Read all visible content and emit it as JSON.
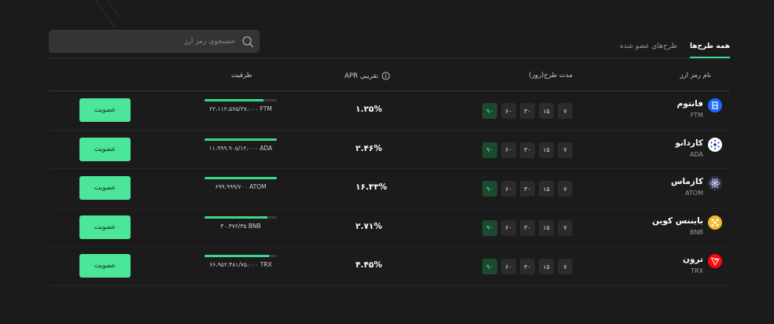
{
  "search": {
    "placeholder": "جستجوی رمز ارز"
  },
  "tabs": [
    {
      "label": "همه طرح‌ها"
    },
    {
      "label": "طرح‌های عضو شده"
    }
  ],
  "table": {
    "headers": {
      "name": "نام رمز ارز",
      "period": "مدت طرح(روز)",
      "apr": "APR تقریبی",
      "capacity": "ظرفیت"
    },
    "period_options": [
      "۷",
      "۱۵",
      "۳۰",
      "۶۰",
      "۹۰"
    ],
    "join_label": "عضویت",
    "rows": [
      {
        "name": "فانتوم",
        "symbol": "FTM",
        "apr": "۱.۲۵%",
        "capacity": "۲۲،۱۱۲،۵۶۵/۲۷،۰۰۰ FTM",
        "fill": 0.82,
        "icon_color": "#1969ff"
      },
      {
        "name": "کاردانو",
        "symbol": "ADA",
        "apr": "۲.۴۶%",
        "capacity": "۱۱،۹۹۹.۹۰۵/۱۲،۰۰۰ ADA",
        "fill": 1.0,
        "icon_color": "#ffffff"
      },
      {
        "name": "کازماس",
        "symbol": "ATOM",
        "apr": "۱۶.۳۳%",
        "capacity": "۶۹۹.۹۹۹/۷۰۰ ATOM",
        "fill": 1.0,
        "icon_color": "#2e3148"
      },
      {
        "name": "بایننس کوین",
        "symbol": "BNB",
        "apr": "۲.۷۱%",
        "capacity": "۳۰.۳۷۶/۳۵ BNB",
        "fill": 0.87,
        "icon_color": "#f3ba2f"
      },
      {
        "name": "ترون",
        "symbol": "TRX",
        "apr": "۴.۴۵%",
        "capacity": "۶۶،۹۵۲.۴۸۱/۷۵،۰۰۰ TRX",
        "fill": 0.89,
        "icon_color": "#ff060a"
      }
    ]
  }
}
